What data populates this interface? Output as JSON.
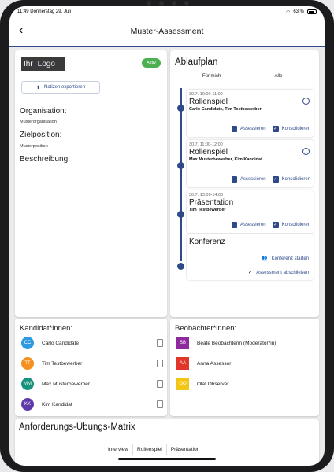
{
  "status": {
    "time": "11:49",
    "date": "Donnerstag 29. Juli",
    "battery": "63 %"
  },
  "nav": {
    "back": "‹",
    "title": "Muster-Assessment"
  },
  "left": {
    "logo_word1": "Ihr",
    "logo_word2": "Logo",
    "badge": "Aktiv",
    "export_label": "Notizen exportieren",
    "org_label": "Organisation:",
    "org_value": "Musterorganisation",
    "ziel_label": "Zielposition:",
    "ziel_value": "Musterposition",
    "desc_label": "Beschreibung:"
  },
  "plan": {
    "title": "Ablaufplan",
    "tabs": [
      "Für mich",
      "Alle"
    ],
    "events": [
      {
        "time": "30.7. 10:00-11:00",
        "name": "Rollenspiel",
        "people": "Carlo Candidate, Tim Testbewerber",
        "info": true
      },
      {
        "time": "30.7. 11:00-12:00",
        "name": "Rollenspiel",
        "people": "Max Musterbewerber, Kim Kandidat",
        "info": true
      },
      {
        "time": "30.7. 13:00-14:00",
        "name": "Präsentation",
        "people": "Tim Testbewerber",
        "info": false
      }
    ],
    "assess_label": "Assessieren",
    "consolidate_label": "Konsolidieren",
    "konferenz": {
      "title": "Konferenz",
      "start": "Konferenz starten",
      "finish": "Assessment abschließen"
    }
  },
  "candidates": {
    "title": "Kandidat*innen:",
    "list": [
      {
        "initials": "CC",
        "name": "Carlo Candidate",
        "color": "#2f9ae0"
      },
      {
        "initials": "TT",
        "name": "Tim Testbewerber",
        "color": "#f5901e"
      },
      {
        "initials": "MM",
        "name": "Max Musterbewerber",
        "color": "#17937d"
      },
      {
        "initials": "KK",
        "name": "Kim Kandidat",
        "color": "#5e3aa9"
      }
    ]
  },
  "observers": {
    "title": "Beobachter*innen:",
    "list": [
      {
        "initials": "BB",
        "name": "Beate Beobachterin (Moderator*in)",
        "color": "#8e2a9e"
      },
      {
        "initials": "AA",
        "name": "Anna Assessor",
        "color": "#e2362b"
      },
      {
        "initials": "OO",
        "name": "Olaf Observer",
        "color": "#f3c515"
      }
    ]
  },
  "matrix": {
    "title": "Anforderungs-Übungs-Matrix",
    "columns": [
      "Interview",
      "Rollenspiel",
      "Präsentation"
    ]
  }
}
